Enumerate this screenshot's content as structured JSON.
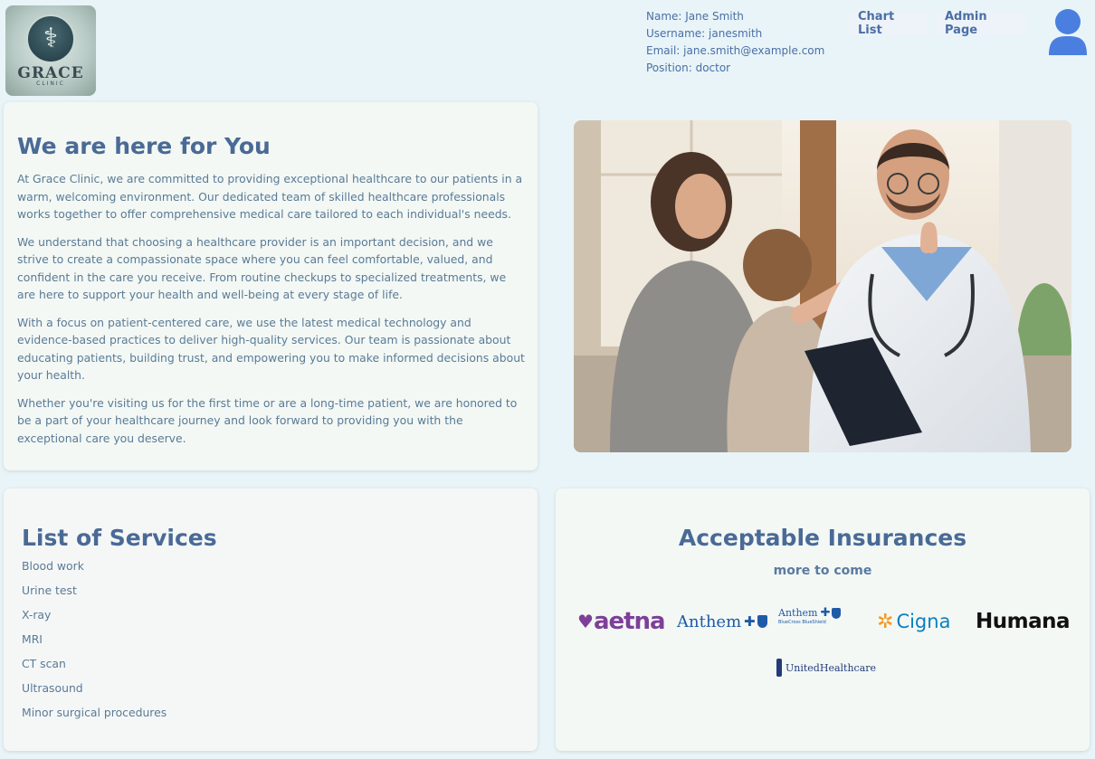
{
  "header": {
    "logo": {
      "name": "GRACE",
      "sub": "CLINIC"
    },
    "user": {
      "name": "Name: Jane Smith",
      "username": "Username: janesmith",
      "email": "Email: jane.smith@example.com",
      "position": "Position: doctor"
    },
    "nav": {
      "chart_list": "Chart List",
      "admin_page": "Admin Page"
    },
    "avatar_icon": "user-avatar-icon"
  },
  "about": {
    "title": "We are here for You",
    "paragraphs": [
      "At Grace Clinic, we are committed to providing exceptional healthcare to our patients in a warm, welcoming environment. Our dedicated team of skilled healthcare professionals works together to offer comprehensive medical care tailored to each individual's needs.",
      "We understand that choosing a healthcare provider is an important decision, and we strive to create a compassionate space where you can feel comfortable, valued, and confident in the care you receive. From routine checkups to specialized treatments, we are here to support your health and well-being at every stage of life.",
      "With a focus on patient-centered care, we use the latest medical technology and evidence-based practices to deliver high-quality services. Our team is passionate about educating patients, building trust, and empowering you to make informed decisions about your health.",
      "Whether you're visiting us for the first time or are a long-time patient, we are honored to be a part of your healthcare journey and look forward to providing you with the exceptional care you deserve."
    ]
  },
  "services": {
    "title": "List of Services",
    "items": [
      "Blood work",
      "Urine test",
      "X-ray",
      "MRI",
      "CT scan",
      "Ultrasound",
      "Minor surgical procedures"
    ]
  },
  "insurance": {
    "title": "Acceptable Insurances",
    "subtitle": "more to come",
    "providers": {
      "aetna": "aetna",
      "anthem": "Anthem",
      "anthem_bcbs": "Anthem",
      "anthem_bcbs_sub": "BlueCross BlueShield",
      "cigna": "Cigna",
      "humana": "Humana",
      "uhc": "UnitedHealthcare"
    }
  },
  "colors": {
    "background": "#e8f4f8",
    "heading": "#4a6a96",
    "link": "#4a6fa5",
    "avatar": "#4a7fe0"
  }
}
